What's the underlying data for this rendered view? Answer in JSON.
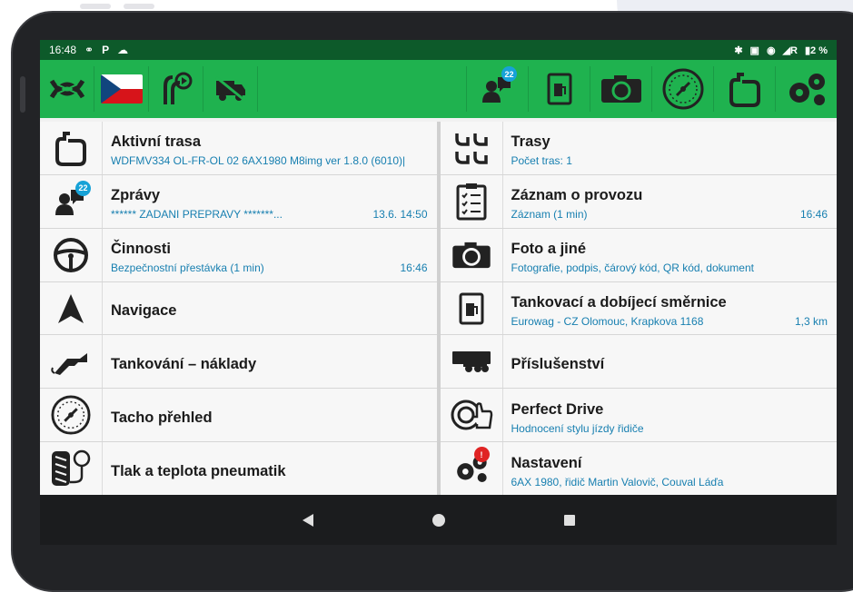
{
  "status": {
    "time": "16:48",
    "battery": "2 %"
  },
  "toolbar": {
    "messages_badge": "22",
    "icons_left": [
      "map-route-icon",
      "czech-flag-icon",
      "route-timer-icon",
      "truck-icon"
    ],
    "icons_right": [
      "messages-icon",
      "fuel-document-icon",
      "camera-icon",
      "tachograph-icon",
      "route-icon",
      "settings-icon"
    ]
  },
  "menu": {
    "left": [
      {
        "title": "Aktivní trasa",
        "subtitle": "WDFMV334 OL-FR-OL 02 6AX1980 M8img ver 1.8.0 (6010)|",
        "time": "",
        "icon": "route-icon"
      },
      {
        "title": "Zprávy",
        "subtitle": "****** ZADANI PREPRAVY *******...",
        "time": "13.6. 14:50",
        "icon": "messages-icon",
        "badge": "22"
      },
      {
        "title": "Činnosti",
        "subtitle": "Bezpečnostní přestávka (1 min)",
        "time": "16:46",
        "icon": "steering-wheel-icon"
      },
      {
        "title": "Navigace",
        "subtitle": "",
        "time": "",
        "icon": "navigation-arrow-icon"
      },
      {
        "title": "Tankování – náklady",
        "subtitle": "",
        "time": "",
        "icon": "fuel-nozzle-icon"
      },
      {
        "title": "Tacho přehled",
        "subtitle": "",
        "time": "",
        "icon": "tachograph-icon"
      },
      {
        "title": "Tlak a teplota pneumatik",
        "subtitle": "",
        "time": "",
        "icon": "tire-pressure-icon"
      }
    ],
    "right": [
      {
        "title": "Trasy",
        "subtitle": "Počet tras: 1",
        "time": "",
        "icon": "routes-icon"
      },
      {
        "title": "Záznam o provozu",
        "subtitle": "Záznam (1 min)",
        "time": "16:46",
        "icon": "clipboard-icon"
      },
      {
        "title": "Foto a jiné",
        "subtitle": "Fotografie, podpis, čárový kód, QR kód, dokument",
        "time": "",
        "icon": "camera-icon"
      },
      {
        "title": "Tankovací a dobíjecí směrnice",
        "subtitle": "Eurowag - CZ Olomouc, Krapkova 1168",
        "time": "1,3 km",
        "icon": "fuel-document-icon"
      },
      {
        "title": "Příslušenství",
        "subtitle": "",
        "time": "",
        "icon": "trailer-icon"
      },
      {
        "title": "Perfect Drive",
        "subtitle": "Hodnocení stylu jízdy řidiče",
        "time": "",
        "icon": "perfect-drive-icon"
      },
      {
        "title": "Nastavení",
        "subtitle": "6AX 1980, řidič Martin Valovič, Couval Láďa",
        "time": "",
        "icon": "settings-icon",
        "badge": "!"
      }
    ]
  },
  "colors": {
    "green": "#1fb24f",
    "darkgreen": "#0d5a2a",
    "link": "#177fb0"
  }
}
